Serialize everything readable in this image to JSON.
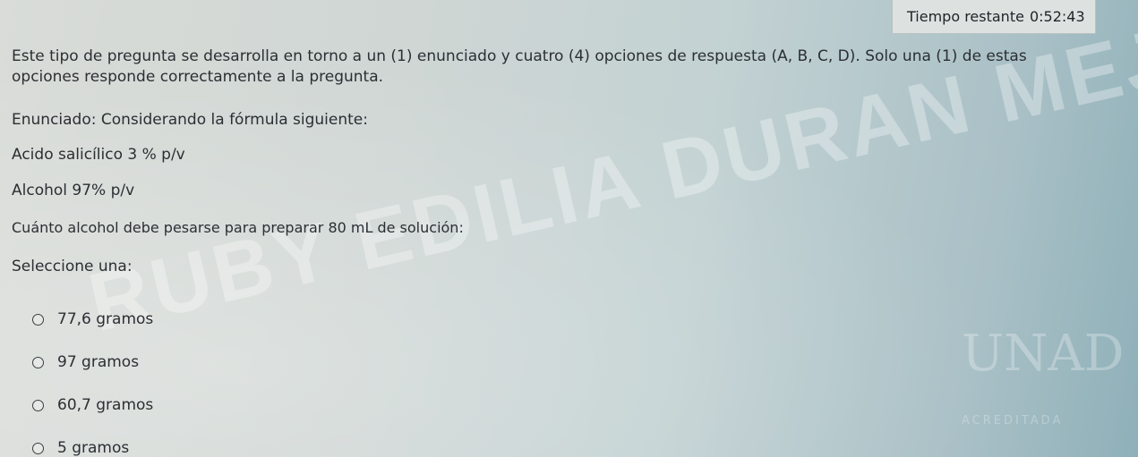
{
  "timer": {
    "label": "Tiempo restante",
    "value": "0:52:43"
  },
  "question": {
    "instructions": "Este tipo de pregunta se desarrolla en torno a un (1) enunciado y cuatro (4) opciones de respuesta (A, B, C, D). Solo una (1) de estas opciones responde correctamente a la pregunta.",
    "statement": "Enunciado: Considerando la fórmula siguiente:",
    "formula": [
      "Acido salicílico 3 % p/v",
      "Alcohol 97% p/v"
    ],
    "prompt": "Cuánto alcohol debe pesarse para preparar 80 mL de solución:",
    "select_label": "Seleccione una:",
    "options": [
      "77,6 gramos",
      "97 gramos",
      "60,7 gramos",
      "5 gramos"
    ]
  },
  "watermark": {
    "text": "RUBY EDILIA DURAN MEJIA"
  },
  "logo": {
    "mark": "UNAD",
    "stamp": "ACREDITADA"
  }
}
